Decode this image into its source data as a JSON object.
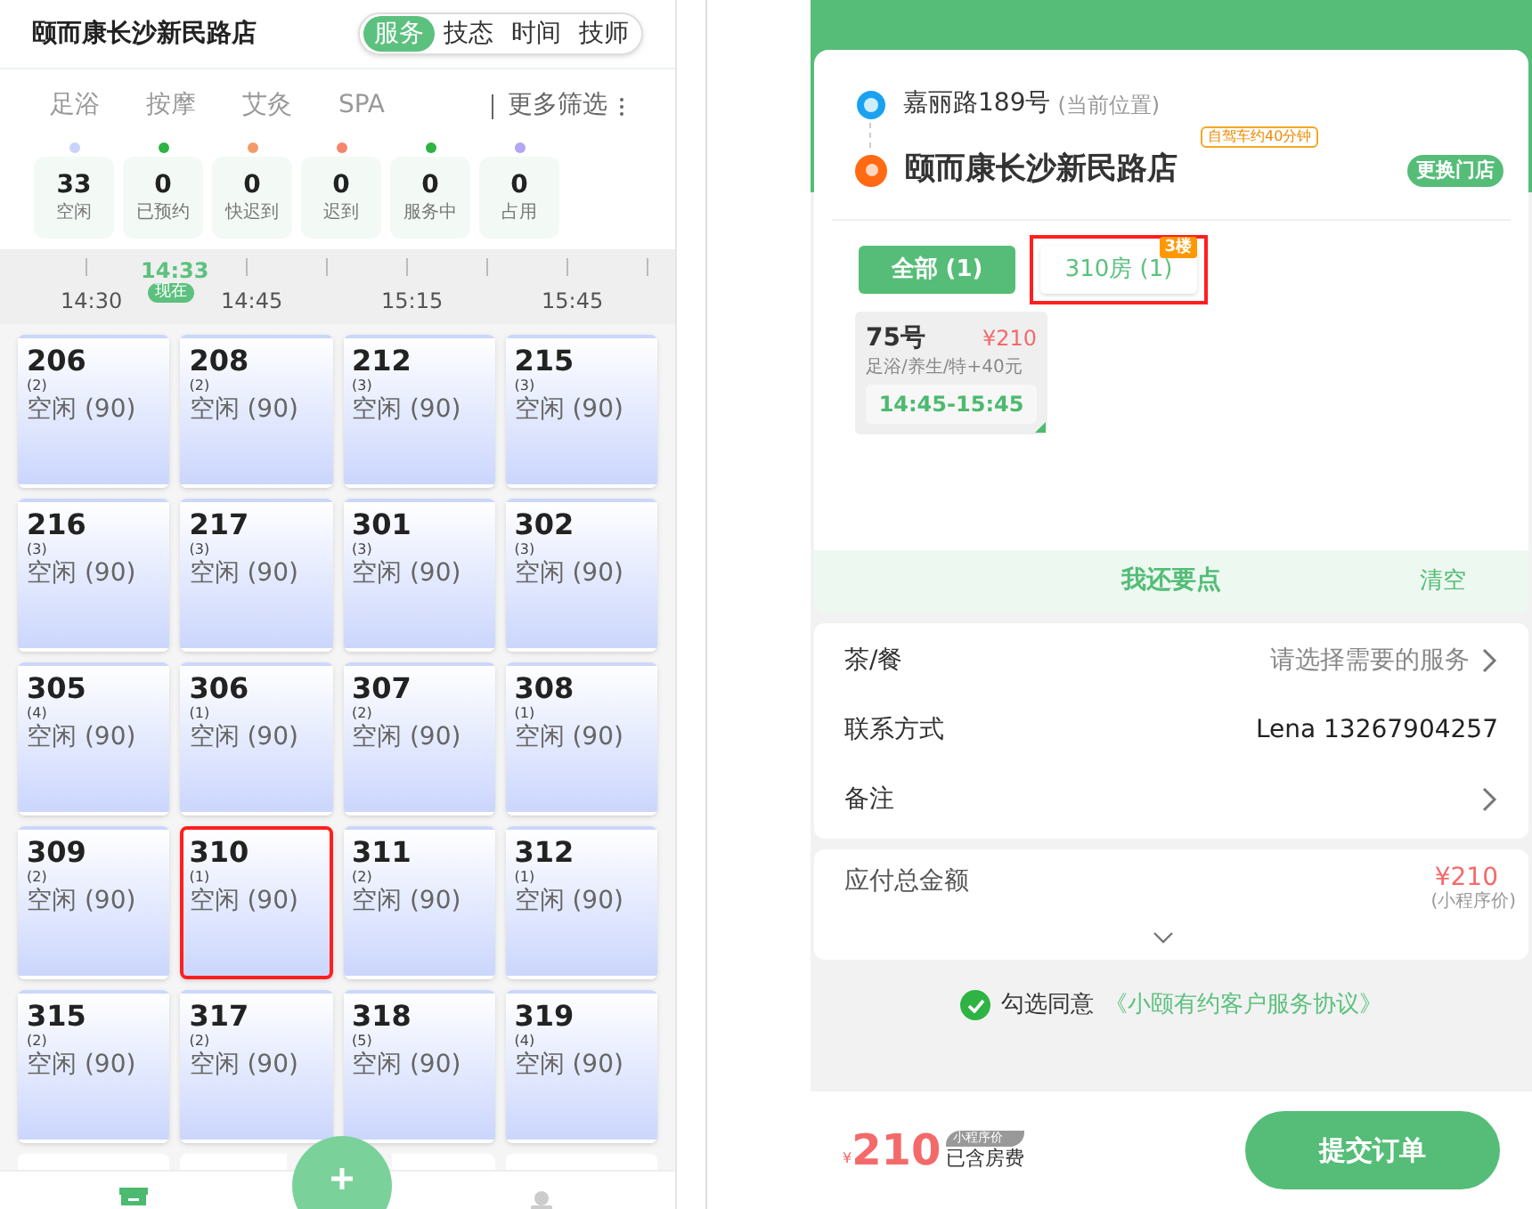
{
  "store_name": "颐而康长沙新民路店",
  "view_tabs": [
    {
      "label": "服务",
      "selected": true
    },
    {
      "label": "技态",
      "selected": false
    },
    {
      "label": "时间",
      "selected": false
    },
    {
      "label": "技师",
      "selected": false
    }
  ],
  "categories": [
    {
      "label": "足浴"
    },
    {
      "label": "按摩"
    },
    {
      "label": "艾灸"
    },
    {
      "label": "SPA"
    }
  ],
  "more_filter": "更多筛选",
  "statuses": [
    {
      "count": "33",
      "label": "空闲",
      "color": "#c9d3fb"
    },
    {
      "count": "0",
      "label": "已预约",
      "color": "#2fb344"
    },
    {
      "count": "0",
      "label": "快迟到",
      "color": "#f59b6b"
    },
    {
      "count": "0",
      "label": "迟到",
      "color": "#f5866b"
    },
    {
      "count": "0",
      "label": "服务中",
      "color": "#2fb344"
    },
    {
      "count": "0",
      "label": "占用",
      "color": "#b3a6f5"
    }
  ],
  "timeline": {
    "now_time": "14:33",
    "now_label": "现在",
    "ticks": [
      "14:30",
      "14:45",
      "15:15",
      "15:45"
    ]
  },
  "rooms": [
    {
      "number": "206",
      "capacity": "(2)",
      "status": "空闲 (90)",
      "highlighted": false
    },
    {
      "number": "208",
      "capacity": "(2)",
      "status": "空闲 (90)",
      "highlighted": false
    },
    {
      "number": "212",
      "capacity": "(3)",
      "status": "空闲 (90)",
      "highlighted": false
    },
    {
      "number": "215",
      "capacity": "(3)",
      "status": "空闲 (90)",
      "highlighted": false
    },
    {
      "number": "216",
      "capacity": "(3)",
      "status": "空闲 (90)",
      "highlighted": false
    },
    {
      "number": "217",
      "capacity": "(3)",
      "status": "空闲 (90)",
      "highlighted": false
    },
    {
      "number": "301",
      "capacity": "(3)",
      "status": "空闲 (90)",
      "highlighted": false
    },
    {
      "number": "302",
      "capacity": "(3)",
      "status": "空闲 (90)",
      "highlighted": false
    },
    {
      "number": "305",
      "capacity": "(4)",
      "status": "空闲 (90)",
      "highlighted": false
    },
    {
      "number": "306",
      "capacity": "(1)",
      "status": "空闲 (90)",
      "highlighted": false
    },
    {
      "number": "307",
      "capacity": "(2)",
      "status": "空闲 (90)",
      "highlighted": false
    },
    {
      "number": "308",
      "capacity": "(1)",
      "status": "空闲 (90)",
      "highlighted": false
    },
    {
      "number": "309",
      "capacity": "(2)",
      "status": "空闲 (90)",
      "highlighted": false
    },
    {
      "number": "310",
      "capacity": "(1)",
      "status": "空闲 (90)",
      "highlighted": true
    },
    {
      "number": "311",
      "capacity": "(2)",
      "status": "空闲 (90)",
      "highlighted": false
    },
    {
      "number": "312",
      "capacity": "(1)",
      "status": "空闲 (90)",
      "highlighted": false
    },
    {
      "number": "315",
      "capacity": "(2)",
      "status": "空闲 (90)",
      "highlighted": false
    },
    {
      "number": "317",
      "capacity": "(2)",
      "status": "空闲 (90)",
      "highlighted": false
    },
    {
      "number": "318",
      "capacity": "(5)",
      "status": "空闲 (90)",
      "highlighted": false
    },
    {
      "number": "319",
      "capacity": "(4)",
      "status": "空闲 (90)",
      "highlighted": false
    }
  ],
  "route": {
    "origin": "嘉丽路189号",
    "origin_note": "(当前位置)",
    "destination": "颐而康长沙新民路店",
    "drive_badge": "自驾车约40分钟",
    "change_button": "更换门店"
  },
  "room_tabs": [
    {
      "label": "全部 (1)",
      "selected": true,
      "highlighted": false
    },
    {
      "label": "310房 (1)",
      "floor": "3楼",
      "selected": false,
      "highlighted": true
    }
  ],
  "technician": {
    "number": "75号",
    "price": "¥210",
    "services": "足浴/养生/特+40元",
    "time": "14:45-15:45"
  },
  "add_more": {
    "label": "我还要点",
    "clear": "清空"
  },
  "form_rows": [
    {
      "label": "茶/餐",
      "value": "请选择需要的服务",
      "kind": "link"
    },
    {
      "label": "联系方式",
      "value": "Lena 13267904257",
      "kind": "text"
    },
    {
      "label": "备注",
      "kind": "link"
    }
  ],
  "total": {
    "label": "应付总金额",
    "amount": "¥210",
    "note": "(小程序价)"
  },
  "agreement": {
    "checked": true,
    "text": "勾选同意",
    "link": "《小颐有约客户服务协议》"
  },
  "footer": {
    "currency": "¥",
    "amount": "210",
    "badge": "小程序价",
    "note": "已含房费",
    "submit": "提交订单"
  }
}
